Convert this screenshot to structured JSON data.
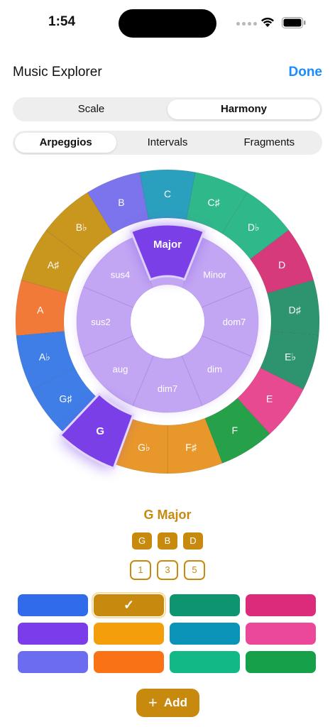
{
  "status_bar": {
    "time": "1:54"
  },
  "nav": {
    "title": "Music Explorer",
    "done_label": "Done"
  },
  "mode_tabs": [
    {
      "label": "Scale",
      "active": false
    },
    {
      "label": "Harmony",
      "active": true
    }
  ],
  "sub_tabs": [
    {
      "label": "Arpeggios",
      "active": true
    },
    {
      "label": "Intervals",
      "active": false
    },
    {
      "label": "Fragments",
      "active": false
    }
  ],
  "wheel": {
    "roots": [
      {
        "label": "C",
        "color": "#2a9fbe"
      },
      {
        "label": "C♯",
        "color": "#2fb88a"
      },
      {
        "label": "D♭",
        "color": "#2fb88a"
      },
      {
        "label": "D",
        "color": "#d63a7a"
      },
      {
        "label": "D♯",
        "color": "#2e9470"
      },
      {
        "label": "E♭",
        "color": "#2e9470"
      },
      {
        "label": "E",
        "color": "#e84a92"
      },
      {
        "label": "F",
        "color": "#27a04a"
      },
      {
        "label": "F♯",
        "color": "#e8982a"
      },
      {
        "label": "G♭",
        "color": "#e8982a"
      },
      {
        "label": "G",
        "color": "#7a3fe6",
        "selected": true
      },
      {
        "label": "G♯",
        "color": "#3f7ee6"
      },
      {
        "label": "A♭",
        "color": "#3f7ee6"
      },
      {
        "label": "A",
        "color": "#f27a38"
      },
      {
        "label": "A♯",
        "color": "#c9961e"
      },
      {
        "label": "B♭",
        "color": "#c9961e"
      },
      {
        "label": "B",
        "color": "#7c74ec"
      }
    ],
    "qualities": [
      {
        "label": "Major",
        "selected": true
      },
      {
        "label": "Minor"
      },
      {
        "label": "dom7"
      },
      {
        "label": "dim"
      },
      {
        "label": "dim7"
      },
      {
        "label": "aug"
      },
      {
        "label": "sus2"
      },
      {
        "label": "sus4"
      }
    ],
    "inner_color": "#c2a6f3",
    "selected_quality_color": "#7a3fe6"
  },
  "chord": {
    "title": "G Major",
    "notes": [
      "G",
      "B",
      "D"
    ],
    "degrees": [
      "1",
      "3",
      "5"
    ],
    "accent_color": "#c78a0e"
  },
  "palette": [
    {
      "color": "#2f6bea"
    },
    {
      "color": "#c78a0e",
      "selected": true,
      "mark": "✓"
    },
    {
      "color": "#0f9470"
    },
    {
      "color": "#db2b7a"
    },
    {
      "color": "#7b3cea"
    },
    {
      "color": "#f59e0b"
    },
    {
      "color": "#0b93b8"
    },
    {
      "color": "#ec4899"
    },
    {
      "color": "#6b6cf0"
    },
    {
      "color": "#f97316"
    },
    {
      "color": "#12b886"
    },
    {
      "color": "#17a04a"
    }
  ],
  "add_button": {
    "label": "Add"
  }
}
